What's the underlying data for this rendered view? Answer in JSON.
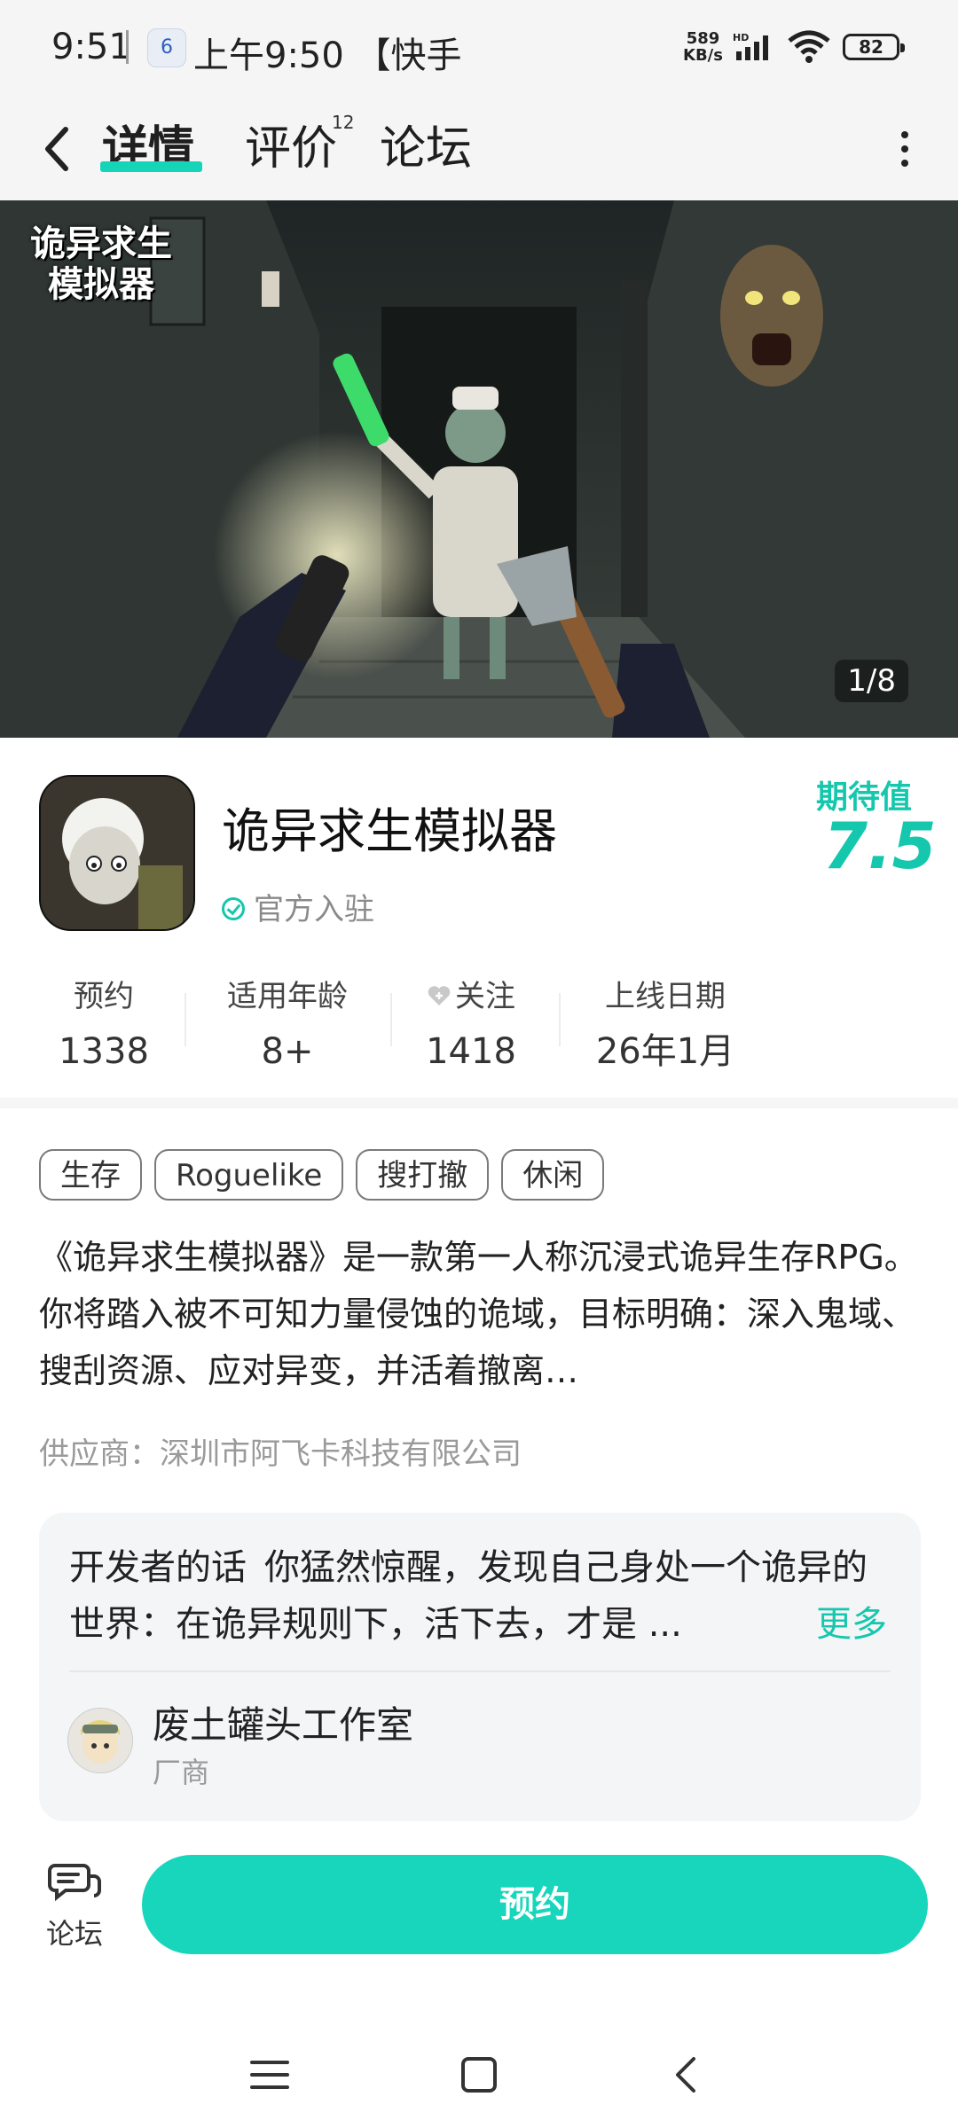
{
  "status_bar": {
    "time": "9:51",
    "notification_icon_text": "6",
    "notification_text": "上午9:50 【快手",
    "network_speed": "589",
    "network_unit": "KB/s",
    "battery": "82"
  },
  "nav": {
    "tabs": [
      {
        "label": "详情",
        "active": true
      },
      {
        "label": "评价",
        "count": "12"
      },
      {
        "label": "论坛"
      }
    ]
  },
  "hero": {
    "logo_text": "诡异求生\n模拟器",
    "counter": "1/8"
  },
  "app": {
    "name": "诡异求生模拟器",
    "badge": "官方入驻",
    "expect_label": "期待值",
    "expect_value": "7.5"
  },
  "stats": [
    {
      "label": "预约",
      "value": "1338"
    },
    {
      "label": "适用年龄",
      "value": "8+"
    },
    {
      "label": "关注",
      "value": "1418"
    },
    {
      "label": "上线日期",
      "value": "26年1月"
    }
  ],
  "tags": [
    "生存",
    "Roguelike",
    "搜打撤",
    "休闲"
  ],
  "description": "《诡异求生模拟器》是一款第一人称沉浸式诡异生存RPG。你将踏入被不可知力量侵蚀的诡域，目标明确：深入鬼域、搜刮资源、应对异变，并活着撤离…",
  "supplier": "供应商：深圳市阿飞卡科技有限公司",
  "developer": {
    "label": "开发者的话",
    "text": "你猛然惊醒，发现自己身处一个诡异的世界：在诡异规则下，活下去，才是 ...",
    "more": "更多",
    "name": "废土罐头工作室",
    "role": "厂商"
  },
  "bottom": {
    "forum_label": "论坛",
    "reserve_label": "预约"
  },
  "colors": {
    "accent": "#17d6bb",
    "accent_text": "#15c7ad"
  }
}
